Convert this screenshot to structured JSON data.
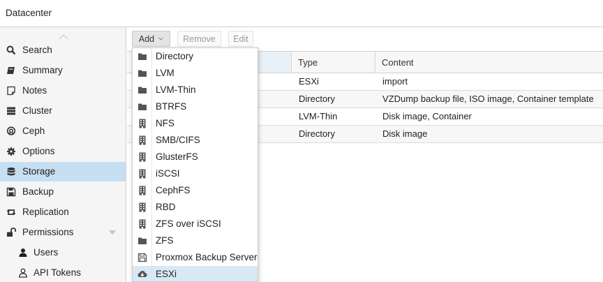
{
  "header": {
    "title": "Datacenter"
  },
  "sidebar": {
    "items": [
      {
        "label": "Search",
        "icon": "search-icon"
      },
      {
        "label": "Summary",
        "icon": "book-icon"
      },
      {
        "label": "Notes",
        "icon": "note-icon"
      },
      {
        "label": "Cluster",
        "icon": "server-icon"
      },
      {
        "label": "Ceph",
        "icon": "ceph-icon"
      },
      {
        "label": "Options",
        "icon": "gear-icon"
      },
      {
        "label": "Storage",
        "icon": "database-icon",
        "active": true
      },
      {
        "label": "Backup",
        "icon": "floppy-icon"
      },
      {
        "label": "Replication",
        "icon": "retweet-icon"
      },
      {
        "label": "Permissions",
        "icon": "unlock-icon"
      },
      {
        "label": "Users",
        "icon": "user-icon"
      },
      {
        "label": "API Tokens",
        "icon": "user-outline-icon"
      }
    ]
  },
  "toolbar": {
    "add_label": "Add",
    "remove_label": "Remove",
    "edit_label": "Edit"
  },
  "grid": {
    "columns": [
      "Type",
      "Content"
    ],
    "rows": [
      {
        "type": "ESXi",
        "content": "import"
      },
      {
        "type": "Directory",
        "content": "VZDump backup file, ISO image, Container template"
      },
      {
        "type": "LVM-Thin",
        "content": "Disk image, Container"
      },
      {
        "type": "Directory",
        "content": "Disk image"
      }
    ]
  },
  "add_menu": {
    "items": [
      {
        "label": "Directory",
        "icon": "folder-icon"
      },
      {
        "label": "LVM",
        "icon": "folder-icon"
      },
      {
        "label": "LVM-Thin",
        "icon": "folder-icon"
      },
      {
        "label": "BTRFS",
        "icon": "folder-icon"
      },
      {
        "label": "NFS",
        "icon": "building-icon"
      },
      {
        "label": "SMB/CIFS",
        "icon": "building-icon"
      },
      {
        "label": "GlusterFS",
        "icon": "building-icon"
      },
      {
        "label": "iSCSI",
        "icon": "building-icon"
      },
      {
        "label": "CephFS",
        "icon": "building-icon"
      },
      {
        "label": "RBD",
        "icon": "building-icon"
      },
      {
        "label": "ZFS over iSCSI",
        "icon": "building-icon"
      },
      {
        "label": "ZFS",
        "icon": "folder-icon"
      },
      {
        "label": "Proxmox Backup Server",
        "icon": "floppy-icon"
      },
      {
        "label": "ESXi",
        "icon": "cloud-download-icon",
        "selected": true
      }
    ]
  },
  "colors": {
    "selection": "#c7dff2",
    "menu_hover": "#d9e8f5",
    "icon": "#444444"
  }
}
